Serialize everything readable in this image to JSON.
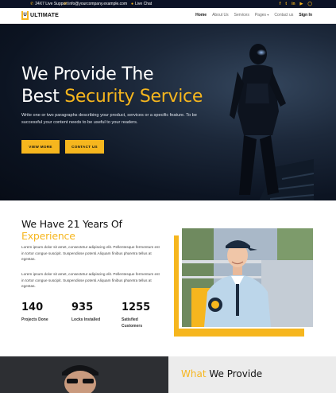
{
  "topbar": {
    "support": "24X7 Live Support",
    "email": "info@yourcompany.example.com",
    "chat": "Live Chat",
    "social": [
      "f",
      "t",
      "in",
      "yt",
      "ig"
    ]
  },
  "nav": {
    "logo_text": "ULTIMATE",
    "logo_mark": "U",
    "items": [
      "Home",
      "About Us",
      "Services",
      "Pages",
      "Contact us",
      "Sign In"
    ]
  },
  "hero": {
    "title_line1": "We Provide The",
    "title_line2_prefix": "Best",
    "title_highlight": "Security Service",
    "text": "Write one or two paragraphs describing your product, services or a specific feature.  To be successful your content needs to be useful to your readers.",
    "btn_view": "VIEW MORE",
    "btn_contact": "CONTACT US"
  },
  "about": {
    "title_line1": "We Have 21 Years Of",
    "title_highlight": "Experience",
    "para1": "Lorem ipsum dolor sit amet, consectetur adipiscing elit. Pellentesque fermentum est in tortor congue suscipit. Suspendisse potenti.Aliquam finibus pharetra tellus at egestas.",
    "para2": "Lorem ipsum dolor sit amet, consectetur adipiscing elit. Pellentesque fermentum est in tortor congue suscipit. Suspendisse potenti.Aliquam finibus pharetra tellus at egestas.",
    "stats": [
      {
        "value": "140",
        "label": "Projects Done"
      },
      {
        "value": "935",
        "label": "Locks Installed"
      },
      {
        "value": "1255",
        "label": "Satisfied Customers"
      }
    ]
  },
  "provide": {
    "highlight": "What",
    "rest": "We Provide"
  },
  "colors": {
    "accent": "#f6b61e",
    "dark": "#0b1226"
  }
}
